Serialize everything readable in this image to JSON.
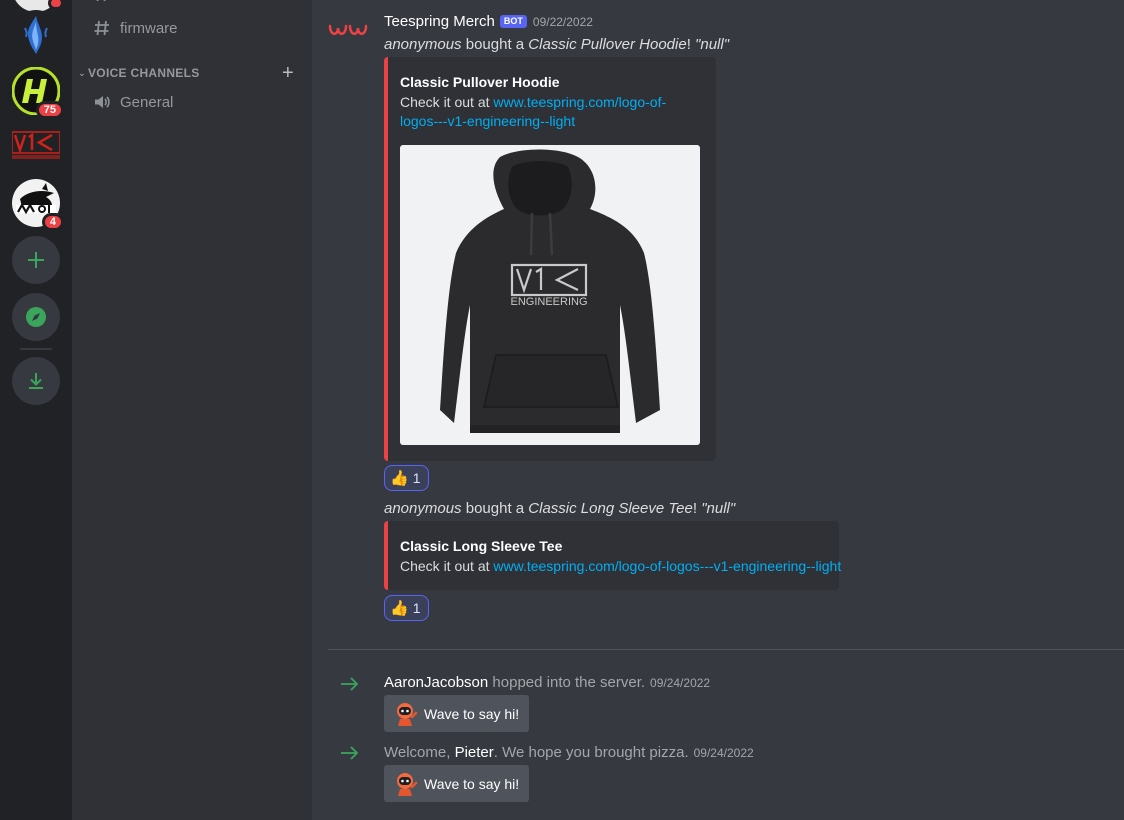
{
  "servers": [
    {
      "name": "server-top-partial",
      "badge": "",
      "active": false
    },
    {
      "name": "server-flame",
      "badge": "",
      "active": false
    },
    {
      "name": "server-h",
      "badge": "75",
      "active": false
    },
    {
      "name": "server-v1-engineering",
      "badge": "",
      "active": true
    },
    {
      "name": "server-marlin",
      "badge": "4",
      "active": false
    }
  ],
  "rail": {
    "add_icon": "plus-icon",
    "explore_icon": "compass-icon",
    "download_icon": "download-icon"
  },
  "channels": {
    "items": [
      {
        "icon": "hash-icon",
        "label": "firmware"
      }
    ],
    "voice_category": "VOICE CHANNELS",
    "voice_items": [
      {
        "icon": "speaker-icon",
        "label": "General"
      }
    ]
  },
  "chat": {
    "message": {
      "author": "Teespring Merch",
      "bot_tag": "BOT",
      "timestamp": "09/22/2022",
      "accent_color": "#ed4245"
    },
    "purchases": [
      {
        "buyer": "anonymous",
        "verb": " bought a ",
        "product": "Classic Pullover Hoodie",
        "bang": "! ",
        "note": "\"null\"",
        "embed_title": "Classic Pullover Hoodie",
        "embed_prefix": "Check it out at ",
        "link_line1": "www.teespring.com/logo-of-",
        "link_line2": "logos---v1-engineering--light",
        "reaction_emoji": "thumbs-up",
        "reaction_count": "1"
      },
      {
        "buyer": "anonymous",
        "verb": " bought a ",
        "product": "Classic Long Sleeve Tee",
        "bang": "! ",
        "note": "\"null\"",
        "embed_title": "Classic Long Sleeve Tee",
        "embed_prefix": "Check it out at ",
        "link": "www.teespring.com/logo-of-logos---v1-engineering--light",
        "reaction_emoji": "thumbs-up",
        "reaction_count": "1"
      }
    ],
    "hoodie_image": {
      "logo_text": "V1",
      "logo_sub": "ENGINEERING"
    },
    "joins": [
      {
        "pre": "",
        "user": "AaronJacobson",
        "post": " hopped into the server.",
        "timestamp": "09/24/2022",
        "button": "Wave to say hi!"
      },
      {
        "pre": "Welcome, ",
        "user": "Pieter",
        "post": ". We hope you brought pizza.",
        "timestamp": "09/24/2022",
        "button": "Wave to say hi!"
      }
    ],
    "system_color": "#3ba55c"
  }
}
